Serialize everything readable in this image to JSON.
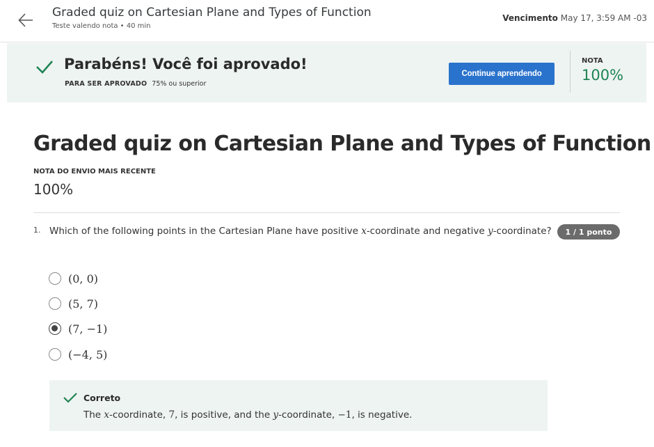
{
  "header": {
    "title": "Graded quiz on Cartesian Plane and Types of Function",
    "subtitle": "Teste valendo nota • 40 min",
    "due_label": "Vencimento",
    "due_value": "May 17, 3:59 AM -03"
  },
  "banner": {
    "message": "Parabéns! Você foi aprovado!",
    "pass_label": "PARA SER APROVADO",
    "pass_value": "75% ou superior",
    "continue_label": "Continue aprendendo",
    "grade_label": "NOTA",
    "grade_value": "100%",
    "accent_color": "#1f8354",
    "button_color": "#2a73cc"
  },
  "main": {
    "title": "Graded quiz on Cartesian Plane and Types of Function",
    "recent_label": "NOTA DO ENVIO MAIS RECENTE",
    "recent_value": "100%"
  },
  "question": {
    "number": "1.",
    "text_parts": [
      "Which of the following points in the Cartesian Plane have positive ",
      "x",
      "-coordinate and negative ",
      "y",
      "-coordinate?"
    ],
    "points": "1 / 1 ponto",
    "options": [
      {
        "label": "(0, 0)",
        "selected": false
      },
      {
        "label": "(5, 7)",
        "selected": false
      },
      {
        "label": "(7, −1)",
        "selected": true
      },
      {
        "label": "(−4, 5)",
        "selected": false
      }
    ]
  },
  "feedback": {
    "title": "Correto",
    "text_parts": [
      "The ",
      "x",
      "-coordinate, ",
      "7",
      ", is positive, and the ",
      "y",
      "-coordinate, ",
      "−1",
      ", is negative."
    ]
  }
}
